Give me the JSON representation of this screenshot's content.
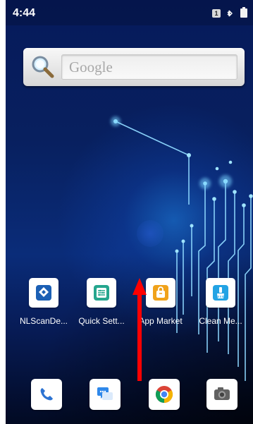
{
  "status_bar": {
    "time": "4:44",
    "sim_badge": "1"
  },
  "search_widget": {
    "placeholder": "Google"
  },
  "apps": [
    {
      "label": "NLScanDe...",
      "icon": "nlscan-icon"
    },
    {
      "label": "Quick Sett...",
      "icon": "quick-settings-icon"
    },
    {
      "label": "App Market",
      "icon": "app-market-icon"
    },
    {
      "label": "Clean Me...",
      "icon": "clean-memory-icon"
    }
  ],
  "dock": [
    {
      "icon": "phone-icon"
    },
    {
      "icon": "messages-icon"
    },
    {
      "icon": "chrome-icon"
    },
    {
      "icon": "camera-icon"
    }
  ],
  "gesture_hint": {
    "direction": "up",
    "color": "#ff0000"
  }
}
